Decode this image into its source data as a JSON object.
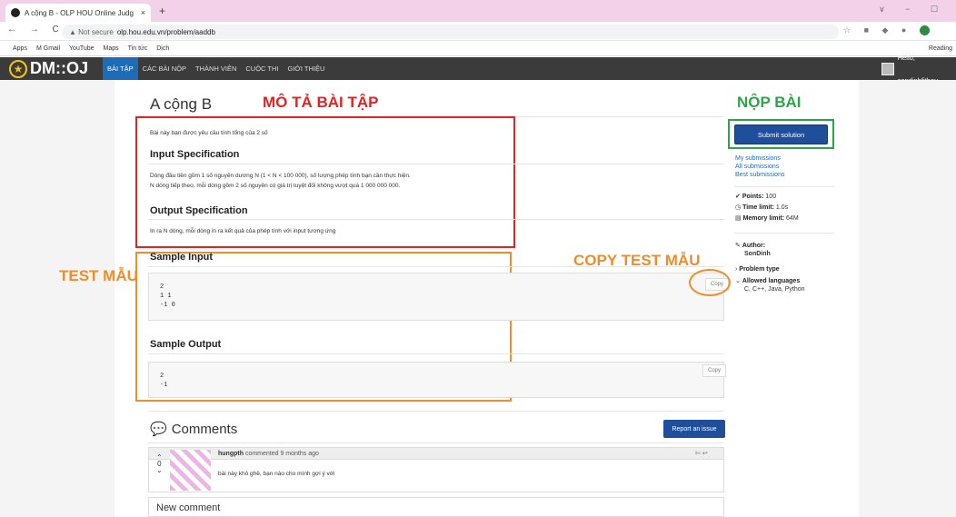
{
  "browser": {
    "tab_title": "A cộng B - OLP HOU Online Judg",
    "tab_close": "×",
    "new_tab": "+",
    "window_controls": "∨ − ☐",
    "nav": "← → C",
    "not_secure": "▲ Not secure",
    "url": "olp.hou.edu.vn/problem/aaddb",
    "bookmarks": [
      "Apps",
      "M Gmail",
      "YouTube",
      "Maps",
      "Tin tức",
      "Dịch"
    ],
    "reading_list": "Reading"
  },
  "site": {
    "logo": "DM::OJ",
    "menu": [
      "BÀI TẬP",
      "CÁC BÀI NỘP",
      "THÀNH VIÊN",
      "CUỘC THI",
      "GIỚI THIỆU"
    ],
    "hello": "Hello, sondinhfithou"
  },
  "problem": {
    "title": "A cộng B",
    "intro": "Bài này bạn được yêu cầu tính tổng của 2 số",
    "input_heading": "Input Specification",
    "input_line1": "Dòng đầu tiên gồm 1 số nguyên dương N (1 < N < 100 000), số lượng phép tính bạn cần thực hiện.",
    "input_line2": "N dòng tiếp theo, mỗi dòng gồm 2 số nguyên có giá trị tuyệt đối không vượt quá 1 000 000 000.",
    "output_heading": "Output Specification",
    "output_line": "In ra N dòng, mỗi dòng in ra kết quả của phép tính với input tương ứng",
    "sample_input_heading": "Sample Input",
    "sample_input": "2\n1 1\n-1 0",
    "sample_output_heading": "Sample Output",
    "sample_output": "2\n-1",
    "copy": "Copy"
  },
  "annotations": {
    "describe": "MÔ TẢ BÀI TẬP",
    "submit": "NỘP BÀI",
    "test": "TEST MẪU",
    "copy_test": "COPY TEST MẪU"
  },
  "sidebar": {
    "submit_button": "Submit solution",
    "links": [
      "My submissions",
      "All submissions",
      "Best submissions"
    ],
    "points_label": "Points:",
    "points": "100",
    "time_label": "Time limit:",
    "time": "1.0s",
    "memory_label": "Memory limit:",
    "memory": "64M",
    "author_label": "Author:",
    "author": "SonDinh",
    "problem_type": "Problem type",
    "languages_label": "Allowed languages",
    "languages": "C, C++, Java, Python"
  },
  "comments": {
    "heading": "Comments",
    "report": "Report an issue",
    "author": "hungpth",
    "meta": "commented 9 months ago",
    "votes": "0",
    "text": "bài này khó ghê, bạn nào cho mình gợi ý với",
    "new_comment": "New comment"
  },
  "colors": {
    "red": "#e02424",
    "orange": "#f28c28",
    "green": "#2aa548",
    "primary": "#1f4f9a",
    "header": "#3b3b3b"
  }
}
